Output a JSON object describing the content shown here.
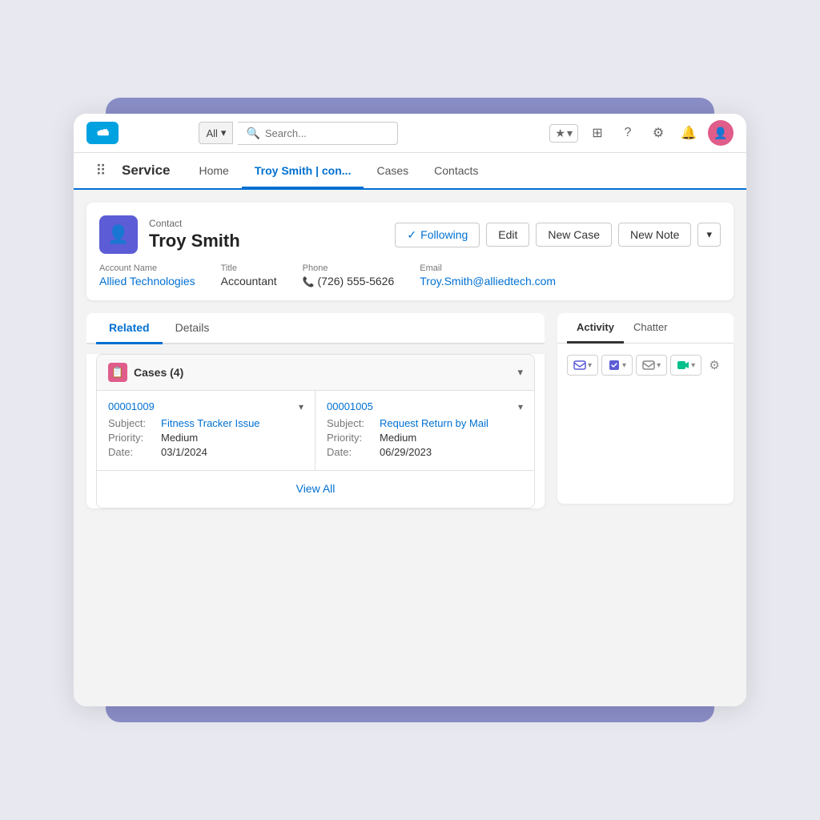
{
  "header": {
    "search_placeholder": "Search...",
    "all_label": "All",
    "app_name": "Service"
  },
  "nav": {
    "items": [
      {
        "label": "Home",
        "active": false
      },
      {
        "label": "Troy Smith | con...",
        "active": true
      },
      {
        "label": "Cases",
        "active": false
      },
      {
        "label": "Contacts",
        "active": false
      }
    ]
  },
  "record": {
    "type": "Contact",
    "name": "Troy Smith",
    "following_label": "Following",
    "edit_label": "Edit",
    "new_case_label": "New Case",
    "new_note_label": "New Note",
    "fields": {
      "account_name_label": "Account Name",
      "account_name_value": "Allied Technologies",
      "title_label": "Title",
      "title_value": "Accountant",
      "phone_label": "Phone",
      "phone_value": "(726) 555-5626",
      "email_label": "Email",
      "email_value": "Troy.Smith@alliedtech.com"
    }
  },
  "tabs": {
    "left": [
      {
        "label": "Related",
        "active": true
      },
      {
        "label": "Details",
        "active": false
      }
    ],
    "right": [
      {
        "label": "Activity",
        "active": true
      },
      {
        "label": "Chatter",
        "active": false
      }
    ]
  },
  "cases": {
    "title": "Cases (4)",
    "items": [
      {
        "case_number": "00001009",
        "subject_label": "Subject:",
        "subject_value": "Fitness Tracker Issue",
        "priority_label": "Priority:",
        "priority_value": "Medium",
        "date_label": "Date:",
        "date_value": "03/1/2024"
      },
      {
        "case_number": "00001005",
        "subject_label": "Subject:",
        "subject_value": "Request Return by Mail",
        "priority_label": "Priority:",
        "priority_value": "Medium",
        "date_label": "Date:",
        "date_value": "06/29/2023"
      }
    ],
    "view_all_label": "View All"
  },
  "activity": {
    "icons": [
      "email",
      "task",
      "log",
      "more"
    ]
  }
}
